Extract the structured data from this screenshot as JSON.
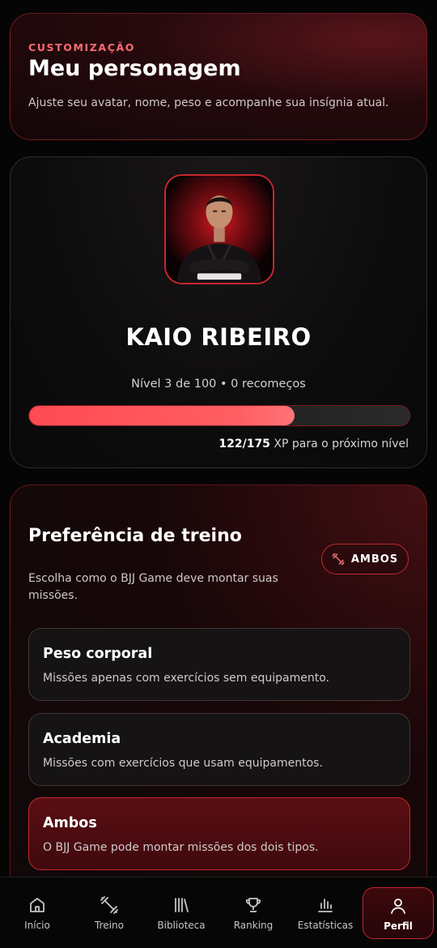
{
  "header": {
    "eyebrow": "CUSTOMIZAÇÃO",
    "title": "Meu personagem",
    "subtitle": "Ajuste seu avatar, nome, peso e acompanhe sua insígnia atual."
  },
  "profile": {
    "name": "KAIO RIBEIRO",
    "level_text": "Nível 3 de 100 • 0 recomeços",
    "xp_current": "122",
    "xp_separator": "/",
    "xp_total": "175",
    "xp_suffix": " XP para o próximo nível",
    "xp_fraction": 0.697
  },
  "preferences": {
    "title": "Preferência de treino",
    "subtitle": "Escolha como o BJJ Game deve montar suas missões.",
    "badge_label": "AMBOS",
    "badge_icon": "dumbbell-icon",
    "options": [
      {
        "title": "Peso corporal",
        "description": "Missões apenas com exercícios sem equipamento.",
        "selected": false
      },
      {
        "title": "Academia",
        "description": "Missões com exercícios que usam equipamentos.",
        "selected": false
      },
      {
        "title": "Ambos",
        "description": "O BJJ Game pode montar missões dos dois tipos.",
        "selected": true
      }
    ]
  },
  "nav": {
    "items": [
      {
        "label": "Início",
        "icon": "home-icon",
        "active": false
      },
      {
        "label": "Treino",
        "icon": "dumbbell-icon",
        "active": false
      },
      {
        "label": "Biblioteca",
        "icon": "library-icon",
        "active": false
      },
      {
        "label": "Ranking",
        "icon": "trophy-icon",
        "active": false
      },
      {
        "label": "Estatísticas",
        "icon": "bar-chart-icon",
        "active": false
      },
      {
        "label": "Perfil",
        "icon": "user-icon",
        "active": true
      }
    ]
  },
  "colors": {
    "accent": "#ff4a52",
    "accent_border": "#c4262e",
    "eyebrow": "#ff6b72"
  }
}
